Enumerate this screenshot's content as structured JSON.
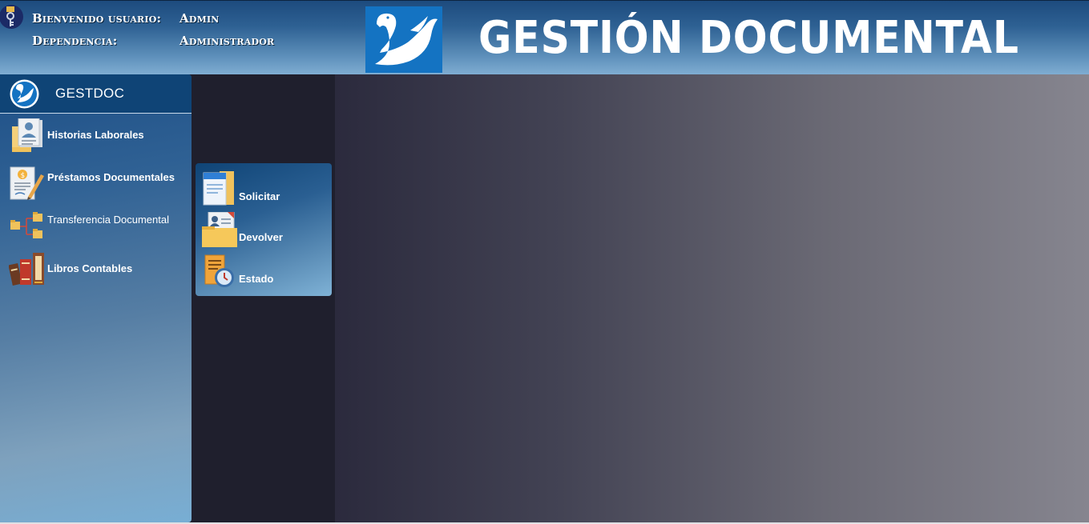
{
  "header": {
    "welcome_label": "Bienvenido usuario:",
    "user_name": "Admin",
    "dependency_label": "Dependencia:",
    "dependency_value": "Administrador",
    "app_title": "GESTIÓN DOCUMENTAL",
    "user_icon": "key-user-icon",
    "logo_icon": "swan-logo-icon"
  },
  "sidebar": {
    "title": "GESTDOC",
    "items": [
      {
        "label": "Historias Laborales",
        "icon": "employee-records-icon",
        "bold": true
      },
      {
        "label": "Préstamos Documentales",
        "icon": "document-loan-icon",
        "bold": true
      },
      {
        "label": "Transferencia Documental",
        "icon": "folder-tree-icon",
        "bold": false
      },
      {
        "label": "Libros Contables",
        "icon": "books-icon",
        "bold": true
      }
    ]
  },
  "submenu": {
    "items": [
      {
        "label": "Solicitar",
        "icon": "request-document-icon"
      },
      {
        "label": "Devolver",
        "icon": "return-folder-icon"
      },
      {
        "label": "Estado",
        "icon": "status-clock-icon"
      }
    ]
  },
  "colors": {
    "header_top": "#1d4b7e",
    "header_bottom": "#7fadd2",
    "sidebar_head": "#0f4476",
    "background_dark": "#1f1f2d",
    "main_right": "#86858f"
  }
}
